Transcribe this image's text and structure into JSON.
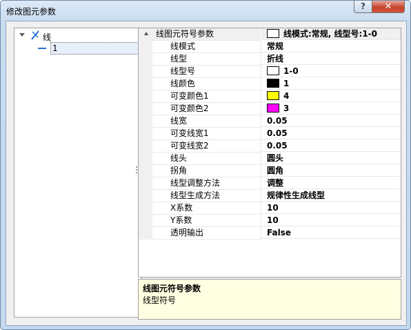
{
  "window": {
    "title": "修改图元参数",
    "help_label": "?",
    "close_label": "✕"
  },
  "tree": {
    "root": {
      "label": "线",
      "icon": "line-symbol-icon"
    },
    "child": {
      "label": "1",
      "icon": "line-style-icon"
    }
  },
  "properties": {
    "group": {
      "name": "线图元符号参数",
      "value": "线模式:常规, 线型号:1-0",
      "swatch_color": "#ffffff"
    },
    "rows": [
      {
        "name": "线模式",
        "value": "常规"
      },
      {
        "name": "线型",
        "value": "折线"
      },
      {
        "name": "线型号",
        "value": "1-0",
        "swatch_color": "#ffffff"
      },
      {
        "name": "线颜色",
        "value": "1",
        "swatch_color": "#000000"
      },
      {
        "name": "可变颜色1",
        "value": "4",
        "swatch_color": "#ffff00"
      },
      {
        "name": "可变颜色2",
        "value": "3",
        "swatch_color": "#ff00ff"
      },
      {
        "name": "线宽",
        "value": "0.05"
      },
      {
        "name": "可变线宽1",
        "value": "0.05"
      },
      {
        "name": "可变线宽2",
        "value": "0.05"
      },
      {
        "name": "线头",
        "value": "圆头"
      },
      {
        "name": "拐角",
        "value": "圆角"
      },
      {
        "name": "线型调整方法",
        "value": "调整"
      },
      {
        "name": "线型生成方法",
        "value": "规律性生成线型"
      },
      {
        "name": "X系数",
        "value": "10"
      },
      {
        "name": "Y系数",
        "value": "10"
      },
      {
        "name": "透明输出",
        "value": "False"
      }
    ]
  },
  "description": {
    "title": "线图元符号参数",
    "text": "线型符号"
  }
}
